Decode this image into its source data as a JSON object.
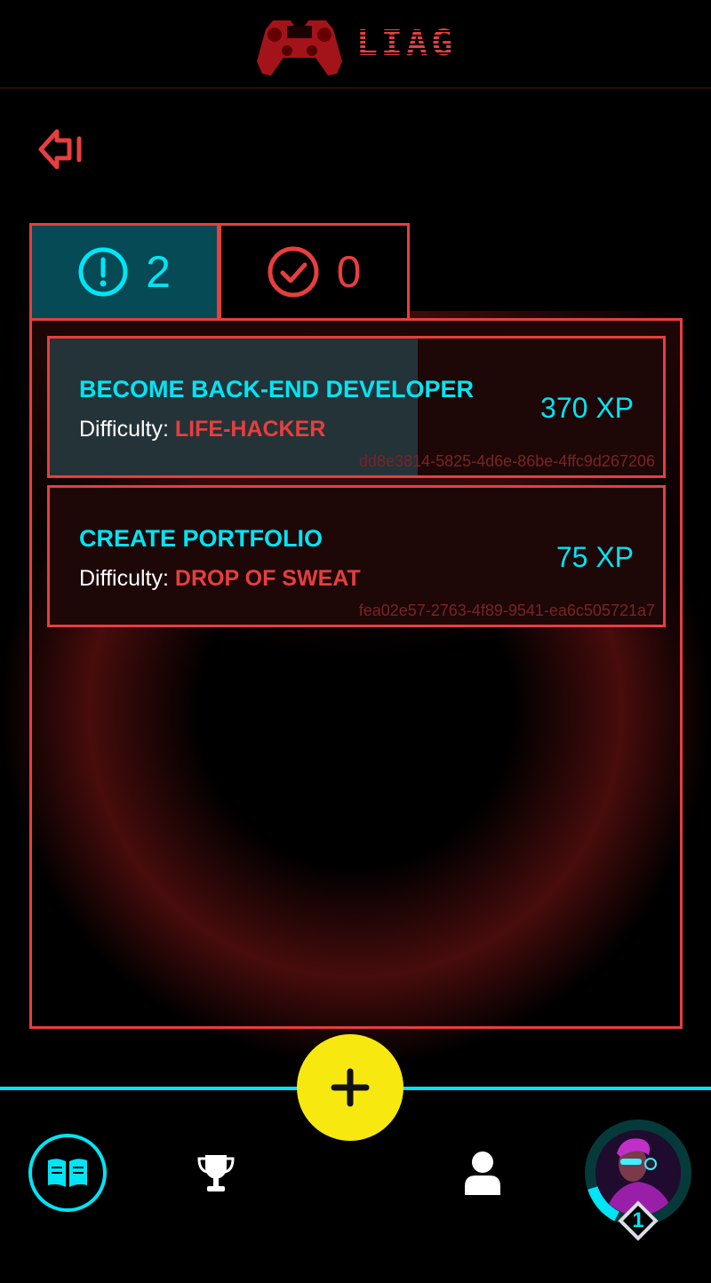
{
  "header": {
    "logo_text": "LIAG"
  },
  "tabs": [
    {
      "name": "active",
      "count": "2"
    },
    {
      "name": "completed",
      "count": "0"
    }
  ],
  "quests": [
    {
      "title": "BECOME BACK-END DEVELOPER",
      "difficulty_label": "Difficulty:",
      "difficulty": "LIFE-HACKER",
      "xp": "370 XP",
      "id": "dd8e3814-5825-4d6e-86be-4ffc9d267206",
      "progress": 0.6
    },
    {
      "title": "CREATE PORTFOLIO",
      "difficulty_label": "Difficulty:",
      "difficulty": "DROP OF SWEAT",
      "xp": "75 XP",
      "id": "fea02e57-2763-4f89-9541-ea6c505721a7",
      "progress": 0
    }
  ],
  "profile": {
    "level": "1",
    "xp_progress": 0.15
  },
  "colors": {
    "accent": "#00e5f5",
    "danger": "#e83e3e",
    "fab": "#f7e90f"
  }
}
